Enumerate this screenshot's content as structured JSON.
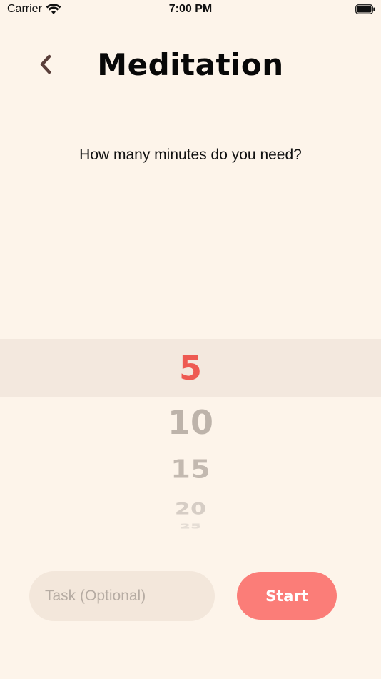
{
  "status_bar": {
    "carrier": "Carrier",
    "time": "7:00 PM",
    "icons": [
      "wifi-icon",
      "battery-icon"
    ]
  },
  "header": {
    "back_icon": "chevron-left-icon",
    "title": "Meditation"
  },
  "prompt": {
    "question": "How many minutes do you need?"
  },
  "picker": {
    "selected": "5",
    "options": [
      "5",
      "10",
      "15",
      "20",
      "25"
    ]
  },
  "task": {
    "value": "",
    "placeholder": "Task (Optional)"
  },
  "actions": {
    "start_label": "Start"
  },
  "colors": {
    "background": "#fdf4ea",
    "accent": "#ee5a52",
    "button": "#fb7d78",
    "highlight": "#f3e8de",
    "back_icon": "#5a3f3a"
  }
}
